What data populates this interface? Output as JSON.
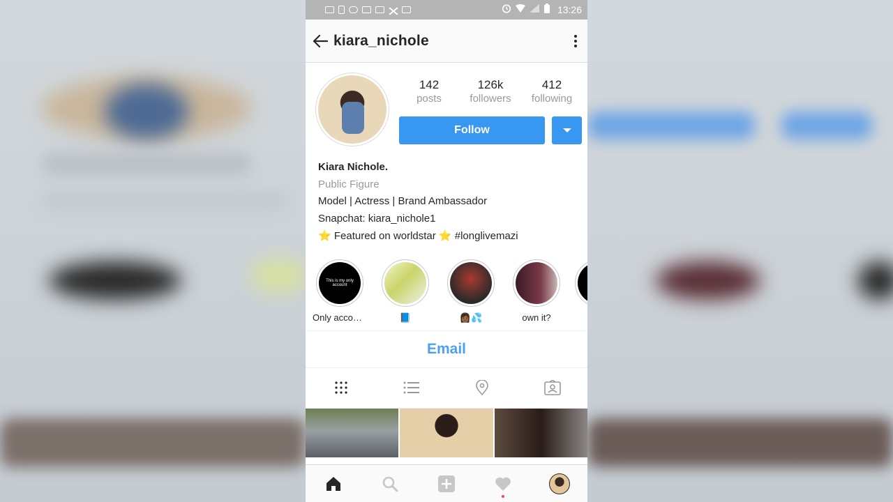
{
  "status_bar": {
    "time": "13:26"
  },
  "header": {
    "username": "kiara_nichole"
  },
  "stats": [
    {
      "value": "142",
      "label": "posts"
    },
    {
      "value": "126k",
      "label": "followers"
    },
    {
      "value": "412",
      "label": "following"
    }
  ],
  "actions": {
    "follow_label": "Follow"
  },
  "bio": {
    "name": "Kiara Nichole.",
    "category": "Public Figure",
    "line1": "Model | Actress | Brand Ambassador",
    "line2": "Snapchat: kiara_nichole1",
    "line3": "⭐ Featured on worldstar ⭐ #longlivemazi"
  },
  "highlights": [
    {
      "label": "Only accoun...",
      "thumb_text": "This is my only account",
      "color": "#000000"
    },
    {
      "label": "📘",
      "color": "#cfd7a8"
    },
    {
      "label": "👩🏾💦",
      "color": "#7a2a28"
    },
    {
      "label": "own it?",
      "color": "#5a2a3a"
    }
  ],
  "contact": {
    "email_label": "Email"
  },
  "tabs": [
    "grid-icon",
    "list-icon",
    "location-pin-icon",
    "tagged-icon"
  ],
  "bottom_nav": [
    "home-icon",
    "search-icon",
    "add-post-icon",
    "activity-heart-icon",
    "profile-avatar"
  ],
  "colors": {
    "accent": "#3897f0",
    "status_bar": "#b4b4b4",
    "notification_dot": "#ed4956"
  }
}
